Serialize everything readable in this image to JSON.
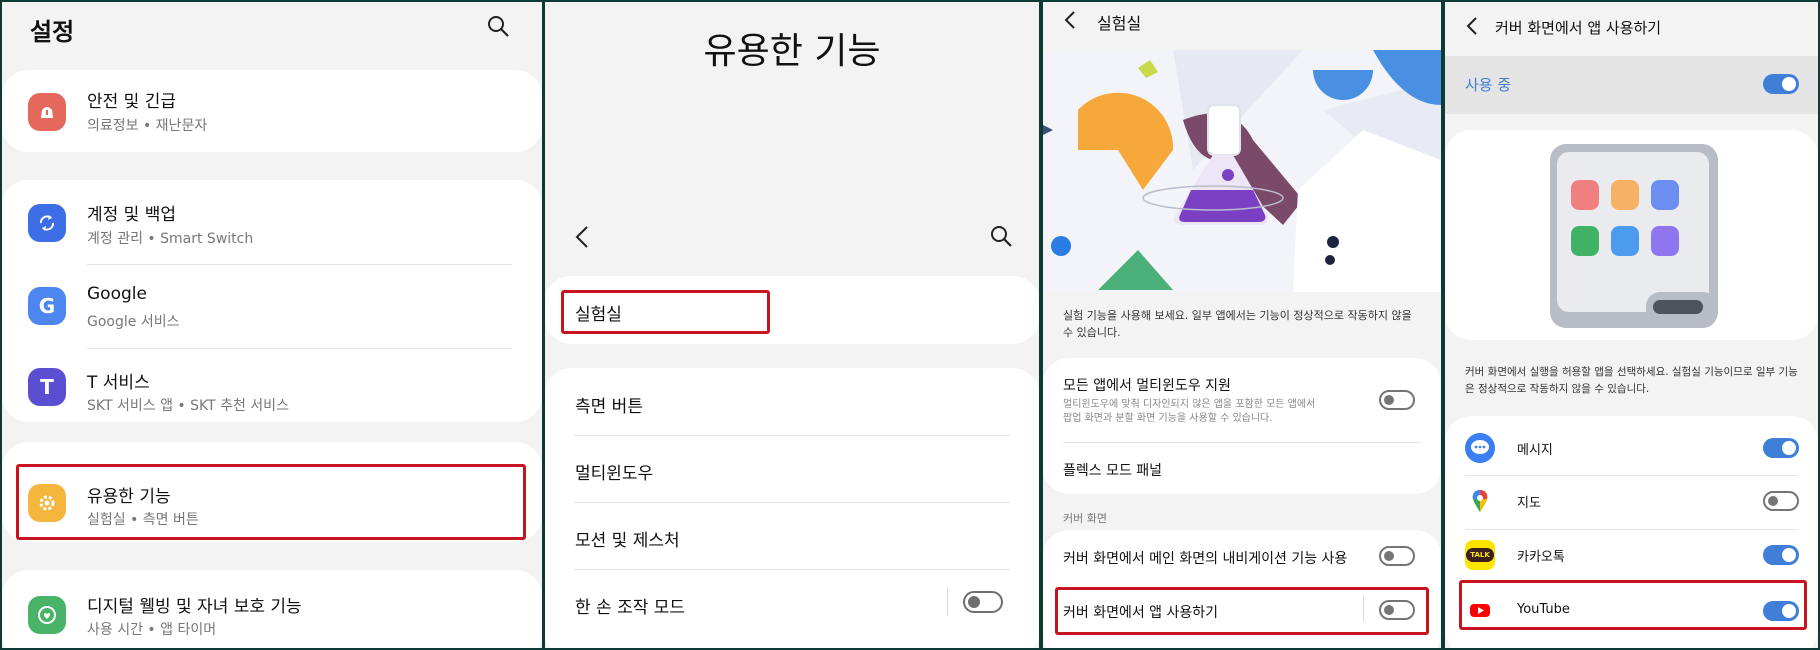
{
  "panel1": {
    "header_title": "설정",
    "items": [
      {
        "title": "안전 및 긴급",
        "sub": "의료정보 • 재난문자"
      },
      {
        "title": "계정 및 백업",
        "sub": "계정 관리 • Smart Switch"
      },
      {
        "title": "Google",
        "sub": "Google 서비스"
      },
      {
        "title": "T 서비스",
        "sub": "SKT 서비스 앱 • SKT 추천 서비스"
      },
      {
        "title": "유용한 기능",
        "sub": "실험실 • 측면 버튼"
      },
      {
        "title": "디지털 웰빙 및 자녀 보호 기능",
        "sub": "사용 시간 • 앱 타이머"
      }
    ],
    "icon_letters": {
      "google": "G",
      "tservice": "T"
    }
  },
  "panel2": {
    "big_title": "유용한 기능",
    "items": [
      "실험실",
      "측면 버튼",
      "멀티윈도우",
      "모션 및 제스처",
      "한 손 조작 모드"
    ],
    "one_hand_toggle": false
  },
  "panel3": {
    "header_title": "실험실",
    "description": "실험 기능을 사용해 보세요. 일부 앱에서는 기능이 정상적으로 작동하지 않을 수 있습니다.",
    "multi_title": "모든 앱에서 멀티윈도우 지원",
    "multi_sub": "멀티윈도우에 맞춰 디자인되지 않은 앱을 포함한 모든 앱에서 팝업 화면과 분할 화면 기능을 사용할 수 있습니다.",
    "flex_title": "플렉스 모드 패널",
    "section_label": "커버 화면",
    "nav_title": "커버 화면에서 메인 화면의 내비게이션 기능 사용",
    "cover_apps_title": "커버 화면에서 앱 사용하기",
    "toggles": {
      "multi": false,
      "nav": false,
      "cover_apps": false
    }
  },
  "panel4": {
    "header_title": "커버 화면에서 앱 사용하기",
    "in_use_label": "사용 중",
    "in_use_toggle": true,
    "description": "커버 화면에서 실행을 허용할 앱을 선택하세요. 실험실 기능이므로 일부 기능은 정상적으로 작동하지 않을 수 있습니다.",
    "apps": [
      {
        "name": "메시지",
        "icon": "messages-icon",
        "on": true
      },
      {
        "name": "지도",
        "icon": "maps-icon",
        "on": false
      },
      {
        "name": "카카오톡",
        "icon": "kakaotalk-icon",
        "on": true
      },
      {
        "name": "YouTube",
        "icon": "youtube-icon",
        "on": true
      }
    ],
    "kakao_icon_text": "TALK"
  },
  "colors": {
    "accent": "#3f7fd8",
    "highlight_red": "#c8141e",
    "toggle_off": "#757575"
  }
}
